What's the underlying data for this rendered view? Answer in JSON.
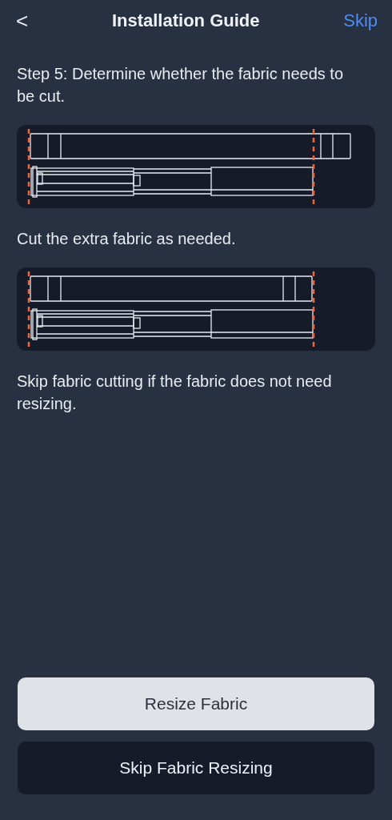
{
  "header": {
    "back": "<",
    "title": "Installation Guide",
    "skip": "Skip"
  },
  "sections": [
    {
      "text": "Step 5: Determine whether the fabric needs to be cut.",
      "diagram": {
        "kind": "uncut"
      }
    },
    {
      "text": "Cut the extra fabric as needed.",
      "diagram": {
        "kind": "cut"
      }
    },
    {
      "text": "Skip fabric cutting if the fabric does not need resizing."
    }
  ],
  "buttons": [
    {
      "label": "Resize Fabric",
      "kind": "primary"
    },
    {
      "label": "Skip Fabric Resizing",
      "kind": "secondary"
    }
  ]
}
